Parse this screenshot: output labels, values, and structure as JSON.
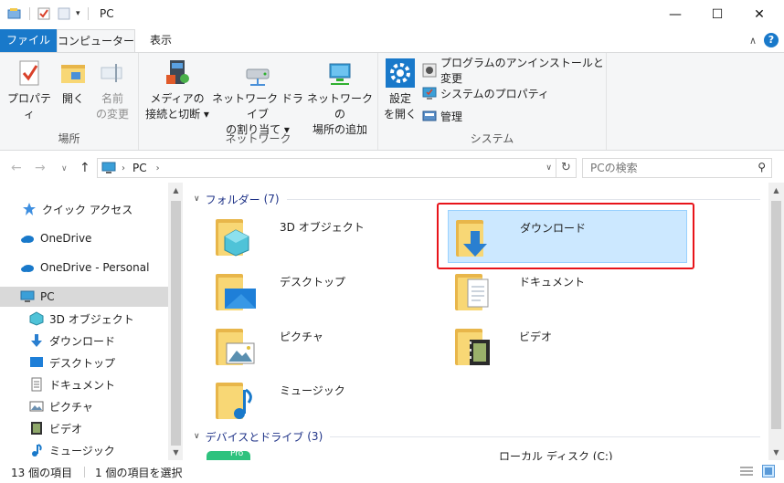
{
  "window": {
    "title": "PC",
    "controls": {
      "minimize": "—",
      "maximize": "☐",
      "close": "✕"
    }
  },
  "ribbon_tabs": {
    "file": "ファイル",
    "computer": "コンピューター",
    "view": "表示"
  },
  "ribbon": {
    "groups": {
      "location": {
        "label": "場所",
        "properties": "プロパティ",
        "open": "開く",
        "rename": [
          "名前",
          "の変更"
        ]
      },
      "network": {
        "label": "ネットワーク",
        "media": [
          "メディアの",
          "接続と切断 ▾"
        ],
        "map_drive": [
          "ネットワーク ドライブ",
          "の割り当て ▾"
        ],
        "add_location": [
          "ネットワークの",
          "場所の追加"
        ]
      },
      "system": {
        "label": "システム",
        "open_settings": [
          "設定",
          "を開く"
        ],
        "uninstall": "プログラムのアンインストールと変更",
        "system_properties": "システムのプロパティ",
        "manage": "管理"
      }
    }
  },
  "address": {
    "crumb": "PC",
    "search_placeholder": "PCの検索"
  },
  "nav_pane": {
    "items": [
      {
        "label": "クイック アクセス",
        "icon": "star-icon"
      },
      {
        "label": "OneDrive",
        "icon": "cloud-icon"
      },
      {
        "label": "OneDrive - Personal",
        "icon": "cloud-icon"
      },
      {
        "label": "PC",
        "icon": "computer-icon"
      },
      {
        "label": "3D オブジェクト",
        "icon": "cube-icon"
      },
      {
        "label": "ダウンロード",
        "icon": "download-icon"
      },
      {
        "label": "デスクトップ",
        "icon": "desktop-icon"
      },
      {
        "label": "ドキュメント",
        "icon": "document-icon"
      },
      {
        "label": "ピクチャ",
        "icon": "picture-icon"
      },
      {
        "label": "ビデオ",
        "icon": "video-icon"
      },
      {
        "label": "ミュージック",
        "icon": "music-icon"
      }
    ]
  },
  "content": {
    "folders_group": {
      "title": "フォルダー",
      "count": "(7)"
    },
    "folders": [
      {
        "name": "3D オブジェクト",
        "icon": "3d-objects-folder-icon"
      },
      {
        "name": "ダウンロード",
        "icon": "downloads-folder-icon"
      },
      {
        "name": "デスクトップ",
        "icon": "desktop-folder-icon"
      },
      {
        "name": "ドキュメント",
        "icon": "documents-folder-icon"
      },
      {
        "name": "ピクチャ",
        "icon": "pictures-folder-icon"
      },
      {
        "name": "ビデオ",
        "icon": "videos-folder-icon"
      },
      {
        "name": "ミュージック",
        "icon": "music-folder-icon"
      }
    ],
    "devices_group": {
      "title": "デバイスとドライブ",
      "count": "(3)"
    },
    "devices_partial": {
      "badge": "Pro",
      "drive_name": "ローカル ディスク (C:)"
    }
  },
  "status": {
    "item_count": "13 個の項目",
    "selected": "1 個の項目を選択"
  },
  "colors": {
    "accent": "#1979ca",
    "selection": "#cce8ff",
    "highlight_box": "#e8141a",
    "folder": "#f8d775"
  }
}
